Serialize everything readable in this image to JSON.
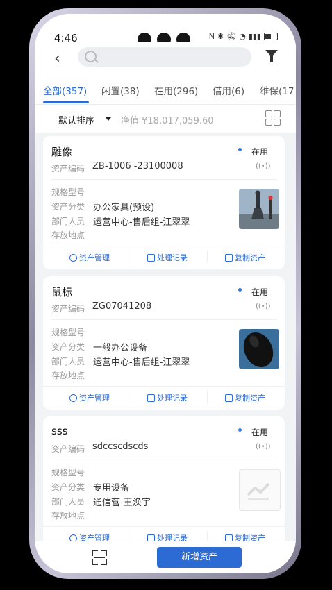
{
  "statusbar": {
    "time": "4:46",
    "icons": [
      "nfc-icon",
      "bluetooth-icon",
      "mute-icon",
      "wifi-icon",
      "signal-icon",
      "battery-icon"
    ]
  },
  "search": {
    "placeholder": ""
  },
  "tabs": [
    {
      "label": "全部(357)",
      "active": true
    },
    {
      "label": "闲置(38)"
    },
    {
      "label": "在用(296)"
    },
    {
      "label": "借用(6)"
    },
    {
      "label": "维保(17"
    }
  ],
  "sortbar": {
    "sort_label": "默认排序",
    "net_value": "净值 ¥18,017,059.60"
  },
  "labels": {
    "code": "资产编码",
    "spec": "规格型号",
    "category": "资产分类",
    "dept": "部门人员",
    "location": "存放地点"
  },
  "actions": {
    "manage": "资产管理",
    "records": "处理记录",
    "copy": "复制资产"
  },
  "cards": [
    {
      "title": "雕像",
      "status": "在用",
      "code": "ZB-1006 -23100008",
      "spec": "",
      "category": "办公家具(预设)",
      "dept": "运营中心-售后组-江翠翠",
      "location": ""
    },
    {
      "title": "鼠标",
      "status": "在用",
      "code": "ZG07041208",
      "spec": "",
      "category": "一般办公设备",
      "dept": "运营中心-售后组-江翠翠",
      "location": ""
    },
    {
      "title": "sss",
      "status": "在用",
      "code": "sdccscdscds",
      "spec": "",
      "category": "专用设备",
      "dept": "通信营-王涣宇",
      "location": ""
    }
  ],
  "bottom": {
    "add_label": "新增资产"
  },
  "colors": {
    "accent": "#2c6bd3",
    "background": "#f2f3f5"
  }
}
